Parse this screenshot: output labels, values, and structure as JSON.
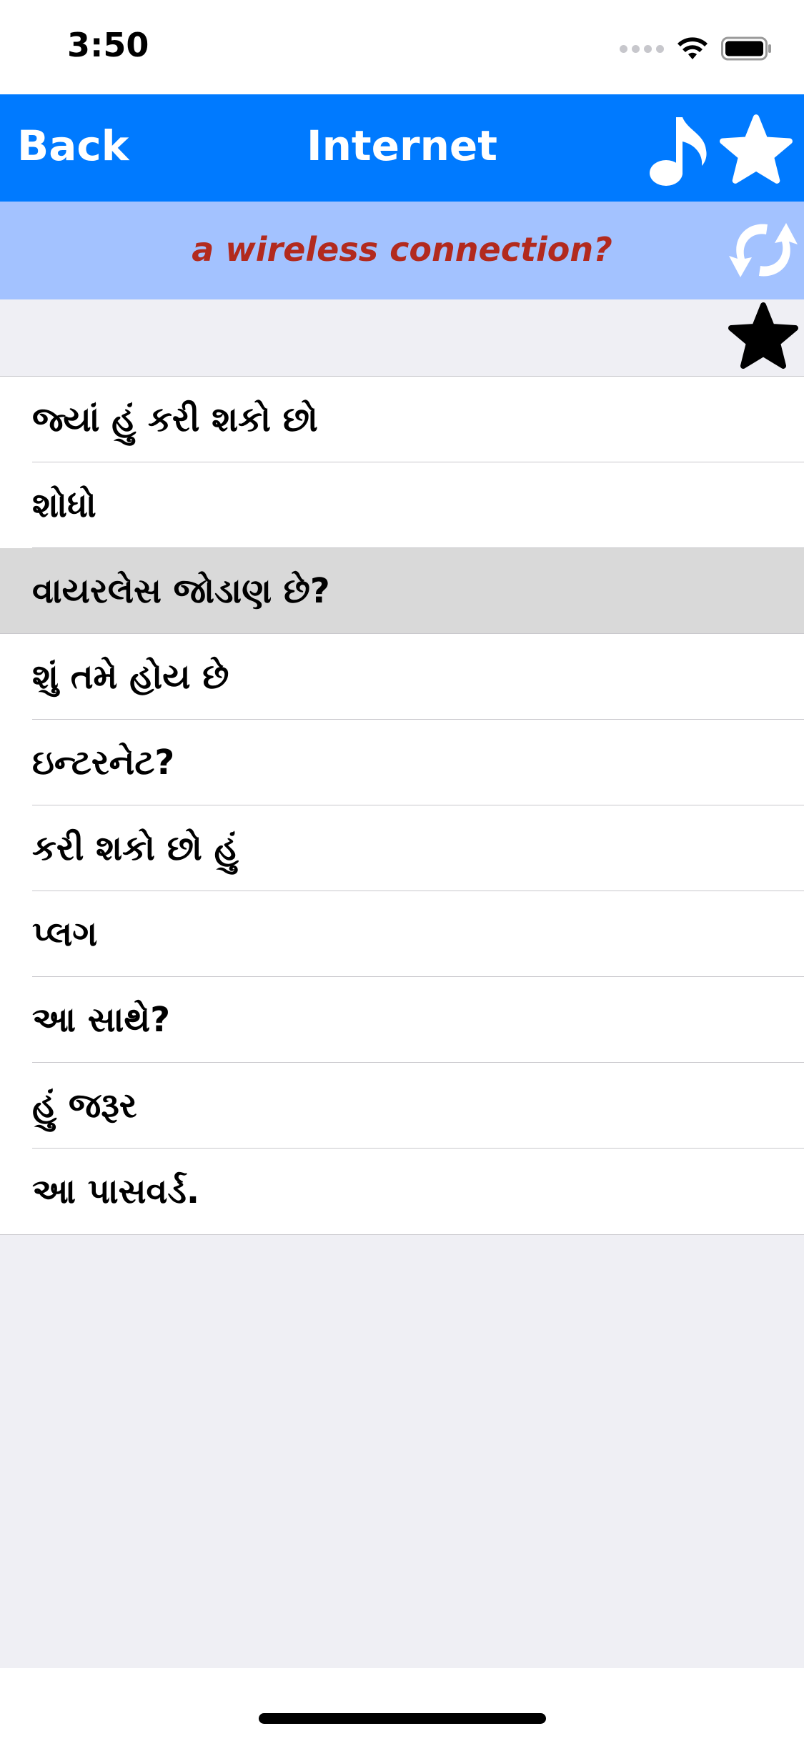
{
  "status_bar": {
    "time": "3:50"
  },
  "nav": {
    "back_label": "Back",
    "title": "Internet"
  },
  "translation": {
    "text": "a wireless connection?"
  },
  "list": {
    "items": [
      {
        "label": "જ્યાં હું કરી શકો છો",
        "selected": false
      },
      {
        "label": "શોધો",
        "selected": false
      },
      {
        "label": "વાયરલેસ જોડાણ છે?",
        "selected": true
      },
      {
        "label": "શું તમે હોય છે",
        "selected": false
      },
      {
        "label": "ઇન્ટરનેટ?",
        "selected": false
      },
      {
        "label": "કરી શકો છો હું",
        "selected": false
      },
      {
        "label": "પ્લગ",
        "selected": false
      },
      {
        "label": "આ સાથે?",
        "selected": false
      },
      {
        "label": "હું જરૂર",
        "selected": false
      },
      {
        "label": "આ પાસવર્ડ.",
        "selected": false
      }
    ]
  },
  "colors": {
    "nav_background": "#007aff",
    "translation_background": "#a3c2ff",
    "translation_text": "#b22a1e",
    "selected_row": "#d9d9d9"
  },
  "icons": {
    "music": "music-note-icon",
    "favorite": "star-icon",
    "swap": "swap-icon",
    "favorite_toggle": "star-filled-icon"
  }
}
